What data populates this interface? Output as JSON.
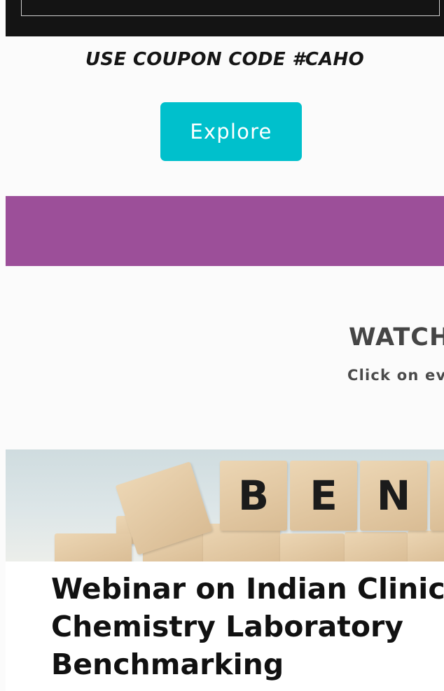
{
  "coupon": {
    "text": "USE COUPON CODE #CAHO"
  },
  "explore_button": {
    "label": "Explore"
  },
  "watch_section": {
    "title": "WATCH",
    "subtitle": "Click on eve"
  },
  "webinar_card": {
    "blocks_letters": [
      "B",
      "E",
      "N"
    ],
    "title": "Webinar on Indian Clinic\nChemistry Laboratory\nBenchmarking"
  },
  "colors": {
    "accent_teal": "#00c0cc",
    "band_purple": "#9c4f99",
    "dark_banner": "#141414"
  }
}
